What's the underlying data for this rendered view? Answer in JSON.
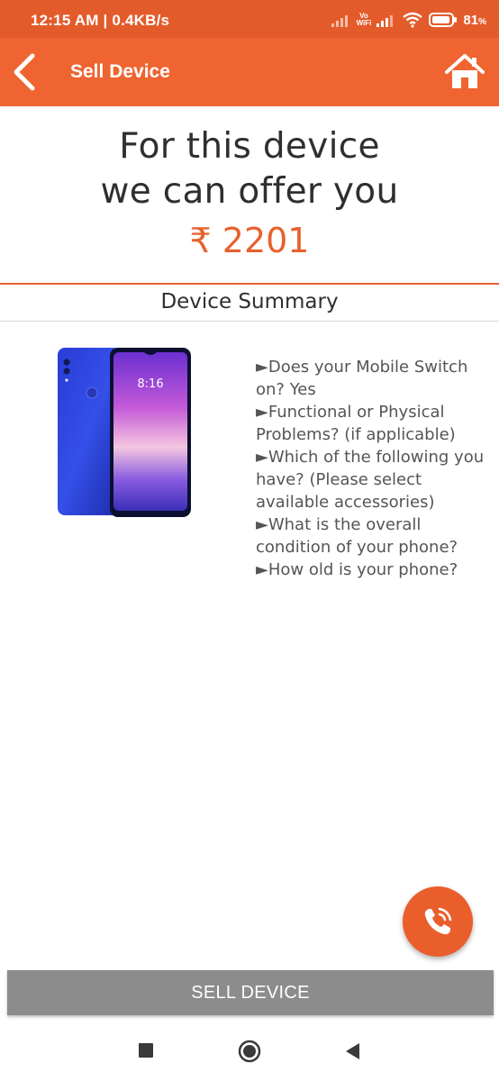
{
  "status_bar": {
    "time": "12:15 AM | 0.4KB/s",
    "vowifi_top": "Vo",
    "vowifi_bottom": "WiFi",
    "battery": "81",
    "battery_unit": "%"
  },
  "app_bar": {
    "title": "Sell Device",
    "back_icon": "chevron-left-icon",
    "home_icon": "home-icon"
  },
  "offer": {
    "line1": "For this device",
    "line2": "we can offer you",
    "price": "₹ 2201"
  },
  "summary": {
    "title": "Device Summary",
    "items": [
      "►Does your Mobile Switch on? Yes",
      "►Functional or Physical Problems? (if applicable)",
      "►Which of the following you have? (Please select available accessories)",
      "►What is the overall condition of your phone?",
      "►How old is your phone?"
    ],
    "phone_screen_time": "8:16"
  },
  "fab": {
    "icon": "phone-call-icon"
  },
  "sell_button": {
    "label": "SELL DEVICE"
  },
  "nav": {
    "recent_icon": "square-icon",
    "home_icon": "circle-icon",
    "back_icon": "triangle-back-icon"
  },
  "colors": {
    "accent": "#ef6430",
    "status_bar": "#e45b2b",
    "button_grey": "#8c8c8c"
  }
}
